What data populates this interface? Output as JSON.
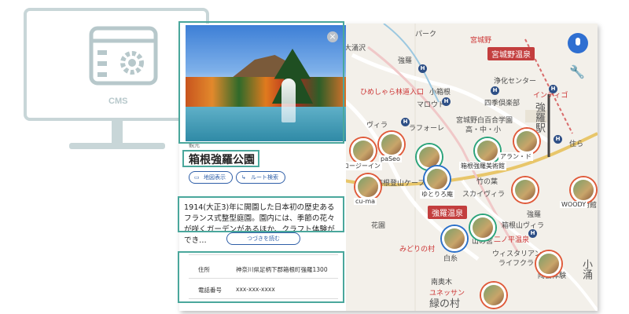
{
  "cms": {
    "label": "CMS"
  },
  "map": {
    "labels": {
      "park": "パーク",
      "miyagino_gate": "宮城野",
      "miyagino_onsen": "宮城野温泉",
      "joka_center": "浄化センター",
      "indy": "インディゴ",
      "oyama": "大涌沢",
      "gora_top": "強羅",
      "himeshara": "ひめしゃら林道入口",
      "kobako": "小箱根",
      "marowd": "マロウド",
      "shiki_club": "四季倶楽部",
      "villa": "ヴィラ",
      "laforet": "ラフォーレ",
      "gora_school": "宮城野白百合学園",
      "kochu": "高・中・小",
      "gora_station": "強羅駅",
      "cable": "箱根登山ケーブル",
      "sumi": "住ら",
      "paseo": "paSeo",
      "forest": "コージーイン",
      "arun": "アラン・ド",
      "gora_art": "箱根強羅美術館",
      "takenoha": "竹の葉",
      "skyvilla": "スカイヴィラ",
      "gora_park": "箱根強羅公園",
      "yutori": "ゆとりろ庵",
      "gora_onsen_badge": "強羅温泉",
      "gora_mid": "強羅",
      "hakone_villa": "箱根山ヴィラ",
      "nino": "二ノ平温泉",
      "kagen": "花園",
      "midori": "みどりの村",
      "yamanoisan": "山の宮",
      "hakone_art": "美術館",
      "wisteria": "ウィスタリアン",
      "lifecraft": "ライフクラフト",
      "toumei": "陶芸体験",
      "woody": "WOODY",
      "kogushi": "小涌",
      "shirasu": "白糸",
      "south": "南奥木",
      "yunessun": "ユネッサン",
      "midori_mura": "緑の村",
      "cuma": "cu-ma"
    }
  },
  "panel": {
    "category": "観光",
    "title": "箱根強羅公園",
    "map_button": "地図表示",
    "route_button": "ルート検索",
    "description": "1914(大正3)年に開園した日本初の歴史あるフランス式整型庭園。園内には、季節の花々が咲くガーデンがあるほか、クラフト体験ができ…",
    "more_button": "つづきを読む",
    "address_label": "住所",
    "address_value": "神奈川県足柄下郡箱根町強羅1300",
    "phone_label": "電話番号",
    "phone_value": "xxx-xxx-xxxx"
  },
  "colors": {
    "highlight": "#4aa79c",
    "accent": "#2f5fa8",
    "badge": "#c33e3e"
  }
}
